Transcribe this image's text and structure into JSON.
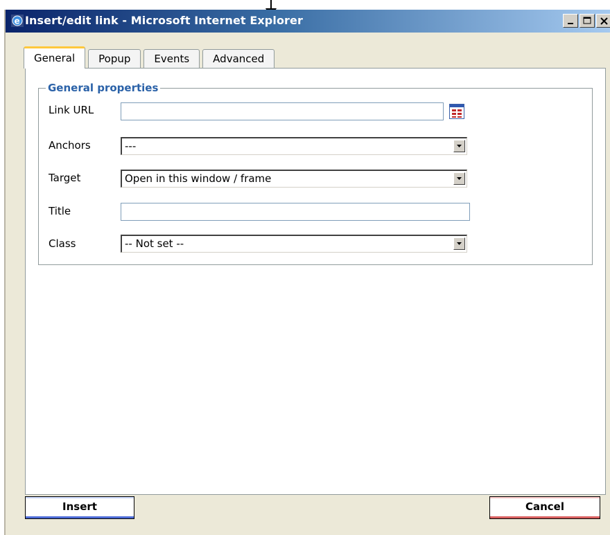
{
  "window": {
    "title": "Insert/edit link - Microsoft Internet Explorer",
    "controls": [
      "minimize-icon",
      "maximize-icon",
      "close-icon"
    ]
  },
  "tabs": [
    {
      "label": "General",
      "active": true
    },
    {
      "label": "Popup",
      "active": false
    },
    {
      "label": "Events",
      "active": false
    },
    {
      "label": "Advanced",
      "active": false
    }
  ],
  "general": {
    "legend": "General properties",
    "link_url": {
      "label": "Link URL",
      "value": ""
    },
    "anchors": {
      "label": "Anchors",
      "value": "---"
    },
    "target": {
      "label": "Target",
      "value": "Open in this window / frame"
    },
    "title": {
      "label": "Title",
      "value": ""
    },
    "class": {
      "label": "Class",
      "value": "-- Not set --"
    }
  },
  "buttons": {
    "insert": "Insert",
    "cancel": "Cancel"
  },
  "colors": {
    "legend": "#2b62a8",
    "active_tab_accent": "#ffc83c",
    "insert_accent": "#4d6bd6",
    "cancel_accent": "#d86060"
  }
}
